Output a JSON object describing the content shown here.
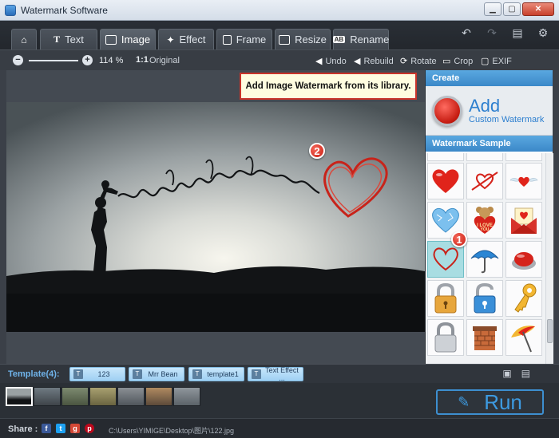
{
  "window": {
    "title": "Watermark Software"
  },
  "tabs": [
    {
      "label": "",
      "icon": "home-icon"
    },
    {
      "label": "Text",
      "icon": "text-icon"
    },
    {
      "label": "Image",
      "icon": "image-icon",
      "active": true
    },
    {
      "label": "Effect",
      "icon": "magic-wand-icon"
    },
    {
      "label": "Frame",
      "icon": "frame-icon"
    },
    {
      "label": "Resize",
      "icon": "resize-icon"
    },
    {
      "label": "Rename",
      "icon": "rename-icon"
    }
  ],
  "toolbar": {
    "zoom": "114 %",
    "original_icon": "1:1",
    "original": "Original",
    "undo": "Undo",
    "rebuild": "Rebuild",
    "rotate": "Rotate",
    "crop": "Crop",
    "exif": "EXIF"
  },
  "canvas": {
    "tooltip": "Add Image Watermark from its library.",
    "badge_watermark": "2",
    "badge_sample": "1"
  },
  "panel": {
    "create_header": "Create",
    "add_title": "Add",
    "add_subtitle": "Custom Watermark",
    "sample_header": "Watermark Sample",
    "samples": [
      "heart-icon",
      "cupid-arrow-icon",
      "winged-heart-icon",
      "crystal-heart-icon",
      "i-love-you-bear-icon",
      "love-letter-icon",
      "sketch-heart-icon",
      "umbrella-icon",
      "red-button-icon",
      "padlock-icon",
      "unlock-icon",
      "key-icon",
      "silver-padlock-icon",
      "brick-chimney-icon",
      "beach-umbrella-icon"
    ]
  },
  "templates": {
    "label": "Template(4):",
    "items": [
      "123",
      "Mrr Bean",
      "template1",
      "Text Effect ..."
    ]
  },
  "run": {
    "label": "Run"
  },
  "status": {
    "share_label": "Share :",
    "path": "C:\\Users\\YIMIGE\\Desktop\\图片\\122.jpg"
  },
  "colors": {
    "accent": "#3b88c8",
    "badge": "#c81d12",
    "tooltip_border": "#c9342a"
  }
}
